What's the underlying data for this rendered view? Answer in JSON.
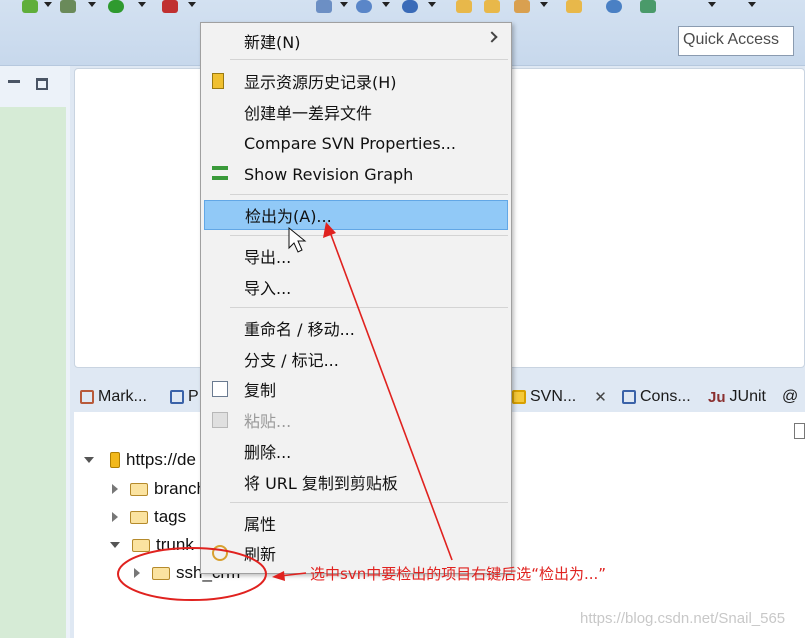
{
  "toolbar": {
    "quick_access": "Quick Access"
  },
  "tabs": [
    {
      "label": "Mark..."
    },
    {
      "label": "P"
    },
    {
      "label": "SVN..."
    },
    {
      "label": "Cons..."
    },
    {
      "label": "JUnit"
    },
    {
      "label": "@"
    }
  ],
  "tree": {
    "root": "https://de",
    "branches": "branch",
    "tags": "tags",
    "trunk": "trunk",
    "project": "ssh_crm"
  },
  "context_menu": {
    "new": "新建(N)",
    "show_history": "显示资源历史记录(H)",
    "create_patch": "创建单一差异文件",
    "compare_props": "Compare SVN Properties...",
    "revision_graph": "Show Revision Graph",
    "checkout_as": "检出为(A)...",
    "export": "导出...",
    "import": "导入...",
    "rename_move": "重命名 / 移动...",
    "branch_tag": "分支 / 标记...",
    "copy": "复制",
    "paste": "粘贴...",
    "delete": "删除...",
    "copy_url": "将 URL 复制到剪贴板",
    "properties": "属性",
    "refresh": "刷新"
  },
  "annotation": {
    "text": "选中svn中要检出的项目右键后选“检出为...”",
    "color": "#e0221f"
  },
  "watermark": "https://blog.csdn.net/Snail_565"
}
